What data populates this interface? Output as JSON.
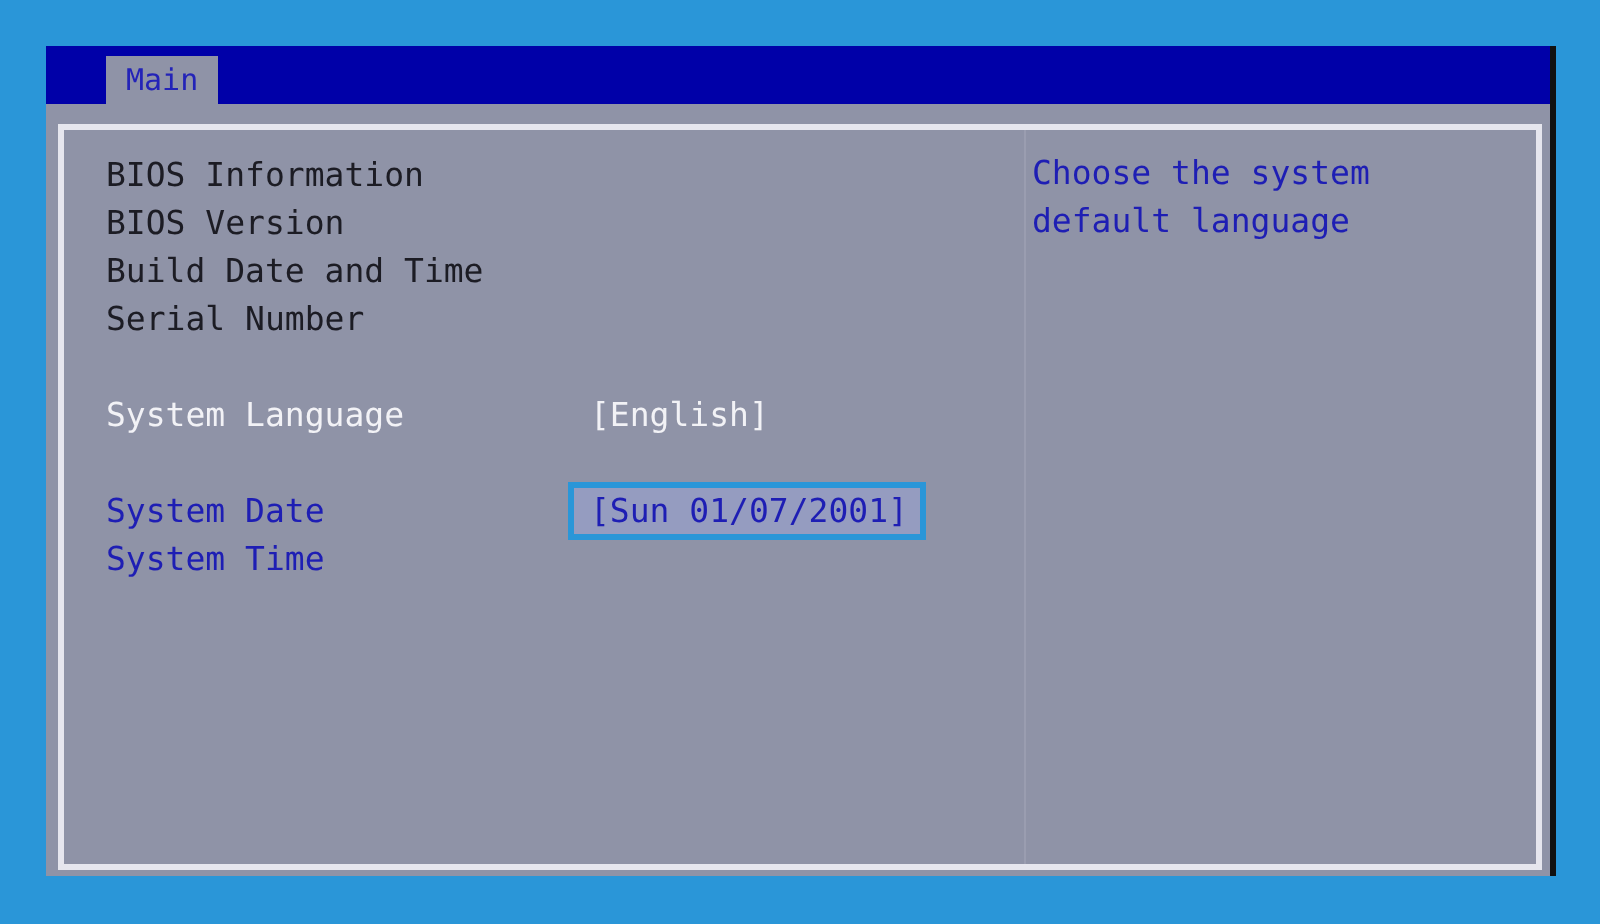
{
  "tabs": [
    {
      "label": "Main",
      "selected": true
    }
  ],
  "groups": [
    {
      "items": [
        {
          "kind": "info",
          "label": "BIOS Information"
        },
        {
          "kind": "info",
          "label": "BIOS Version"
        },
        {
          "kind": "info",
          "label": "Build Date and Time"
        },
        {
          "kind": "info",
          "label": "Serial Number"
        }
      ]
    },
    {
      "items": [
        {
          "kind": "option",
          "label": "System Language",
          "value": "[English]",
          "selected": false
        }
      ]
    },
    {
      "items": [
        {
          "kind": "setting",
          "label": "System Date",
          "value": "[Sun 01/07/2001]",
          "selected": true
        },
        {
          "kind": "setting",
          "label": "System Time",
          "selected": false
        }
      ]
    }
  ],
  "help_text": "Choose the system default language"
}
